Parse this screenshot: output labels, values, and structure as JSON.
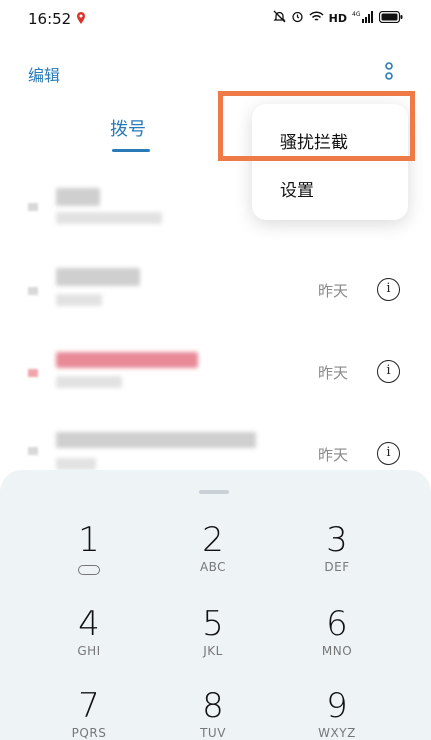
{
  "status_bar": {
    "time": "16:52",
    "network": "HD",
    "signal": "4G",
    "icons": [
      "location-pin-icon",
      "mute-bell-icon",
      "alarm-icon",
      "wifi-icon",
      "hd-icon",
      "signal-icon",
      "battery-icon"
    ]
  },
  "header": {
    "edit_label": "编辑",
    "more_icon": "more-vertical-icon"
  },
  "tabs": {
    "dial_label": "拨号"
  },
  "popup_menu": {
    "items": [
      {
        "label": "骚扰拦截"
      },
      {
        "label": "设置"
      }
    ],
    "highlight_color": "#ee7a47"
  },
  "call_log": [
    {
      "date": ""
    },
    {
      "date": "昨天"
    },
    {
      "date": "昨天",
      "missed": true
    },
    {
      "date": "昨天"
    }
  ],
  "dialpad": {
    "keys": [
      {
        "digit": "1",
        "letters": ""
      },
      {
        "digit": "2",
        "letters": "ABC"
      },
      {
        "digit": "3",
        "letters": "DEF"
      },
      {
        "digit": "4",
        "letters": "GHI"
      },
      {
        "digit": "5",
        "letters": "JKL"
      },
      {
        "digit": "6",
        "letters": "MNO"
      },
      {
        "digit": "7",
        "letters": "PQRS"
      },
      {
        "digit": "8",
        "letters": "TUV"
      },
      {
        "digit": "9",
        "letters": "WXYZ"
      }
    ]
  },
  "colors": {
    "accent": "#2a7ab8",
    "dialpad_bg": "#eef3f6",
    "missed": "#e88a98"
  }
}
